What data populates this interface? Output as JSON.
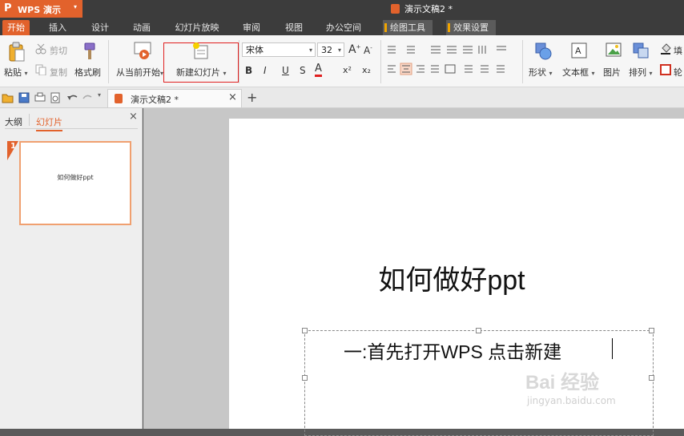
{
  "app": {
    "logo_glyph": "P",
    "name": "WPS 演示",
    "dropdown": "▾"
  },
  "window": {
    "document_title": "演示文稿2 *"
  },
  "menu_tabs": [
    {
      "label": "开始",
      "active": true
    },
    {
      "label": "插入"
    },
    {
      "label": "设计"
    },
    {
      "label": "动画"
    },
    {
      "label": "幻灯片放映"
    },
    {
      "label": "审阅"
    },
    {
      "label": "视图"
    },
    {
      "label": "办公空间"
    },
    {
      "label": "绘图工具",
      "contextual": true
    },
    {
      "label": "效果设置",
      "contextual": true
    }
  ],
  "ribbon": {
    "paste": "粘贴",
    "cut": "剪切",
    "copy": "复制",
    "format_painter": "格式刷",
    "start_from_current": "从当前开始",
    "new_slide": "新建幻灯片",
    "font_name": "宋体",
    "font_size": "32",
    "grow_font": "A",
    "shrink_font": "A",
    "bold": "B",
    "italic": "I",
    "underline": "U",
    "strikethrough": "S",
    "font_color": "A",
    "superscript": "x²",
    "subscript": "x₂",
    "shape": "形状",
    "textbox": "文本框",
    "picture": "图片",
    "arrange": "排列",
    "fill": "填",
    "outline": "轮"
  },
  "doc_tabs": [
    {
      "label": "演示文稿2 *"
    }
  ],
  "panel": {
    "tab_outline": "大纲",
    "tab_slides": "幻灯片",
    "slide_number": "1",
    "thumb_title": "如何做好ppt"
  },
  "slide": {
    "title": "如何做好ppt",
    "body": "一:首先打开WPS  点击新建"
  },
  "watermark": {
    "line1": "Bai 经验",
    "line2": "jingyan.baidu.com"
  },
  "colors": {
    "accent": "#e2622c",
    "highlight_box": "#e02020",
    "dark_bar": "#3c3c3c"
  }
}
